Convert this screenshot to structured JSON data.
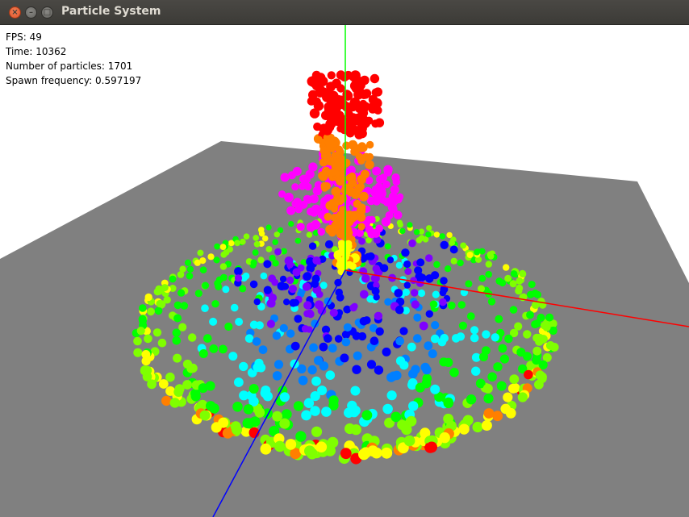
{
  "window": {
    "title": "Particle System",
    "close_glyph": "×",
    "minimize_glyph": "–",
    "maximize_glyph": "□"
  },
  "hud": {
    "fps": "FPS: 49",
    "time": "Time: 10362",
    "particles": "Number of particles: 1701",
    "spawn": "Spawn frequency: 0.597197"
  },
  "scene": {
    "background_color": "#ffffff",
    "ground_color": "#808080",
    "axis_colors": {
      "x": "#ff0000",
      "y": "#00ff00",
      "z": "#0000ff"
    },
    "particle_palette": [
      "#ff0000",
      "#ff7f00",
      "#ffff00",
      "#7fff00",
      "#00ff00",
      "#00ffff",
      "#007fff",
      "#0000ff",
      "#7f00ff",
      "#ff00ff"
    ]
  }
}
